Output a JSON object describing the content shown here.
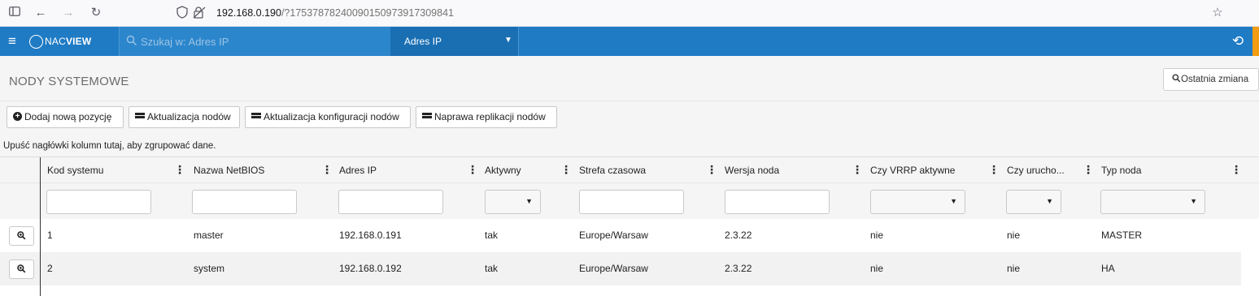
{
  "browser": {
    "url_host": "192.168.0.190",
    "url_path": "/?17537878240090150973917309841"
  },
  "header": {
    "brand_prefix": "NAC",
    "brand_suffix": "VIEW",
    "search_placeholder": "Szukaj w: Adres IP",
    "search_scope": "Adres IP",
    "colors": {
      "primary": "#1f7bc4",
      "accent": "#f39c12"
    }
  },
  "page": {
    "title": "NODY SYSTEMOWE",
    "last_change_label": "Ostatnia zmiana"
  },
  "toolbar": {
    "add_label": "Dodaj nową pozycję",
    "update_nodes_label": "Aktualizacja nodów",
    "update_config_label": "Aktualizacja konfiguracji nodów",
    "repair_replication_label": "Naprawa replikacji nodów"
  },
  "grid": {
    "group_hint": "Upuść nagłówki kolumn tutaj, aby zgrupować dane.",
    "columns": [
      "Kod systemu",
      "Nazwa NetBIOS",
      "Adres IP",
      "Aktywny",
      "Strefa czasowa",
      "Wersja noda",
      "Czy VRRP aktywne",
      "Czy urucho...",
      "Typ noda"
    ],
    "rows": [
      [
        "1",
        "master",
        "192.168.0.191",
        "tak",
        "Europe/Warsaw",
        "2.3.22",
        "nie",
        "nie",
        "MASTER"
      ],
      [
        "2",
        "system",
        "192.168.0.192",
        "tak",
        "Europe/Warsaw",
        "2.3.22",
        "nie",
        "nie",
        "HA"
      ]
    ]
  }
}
